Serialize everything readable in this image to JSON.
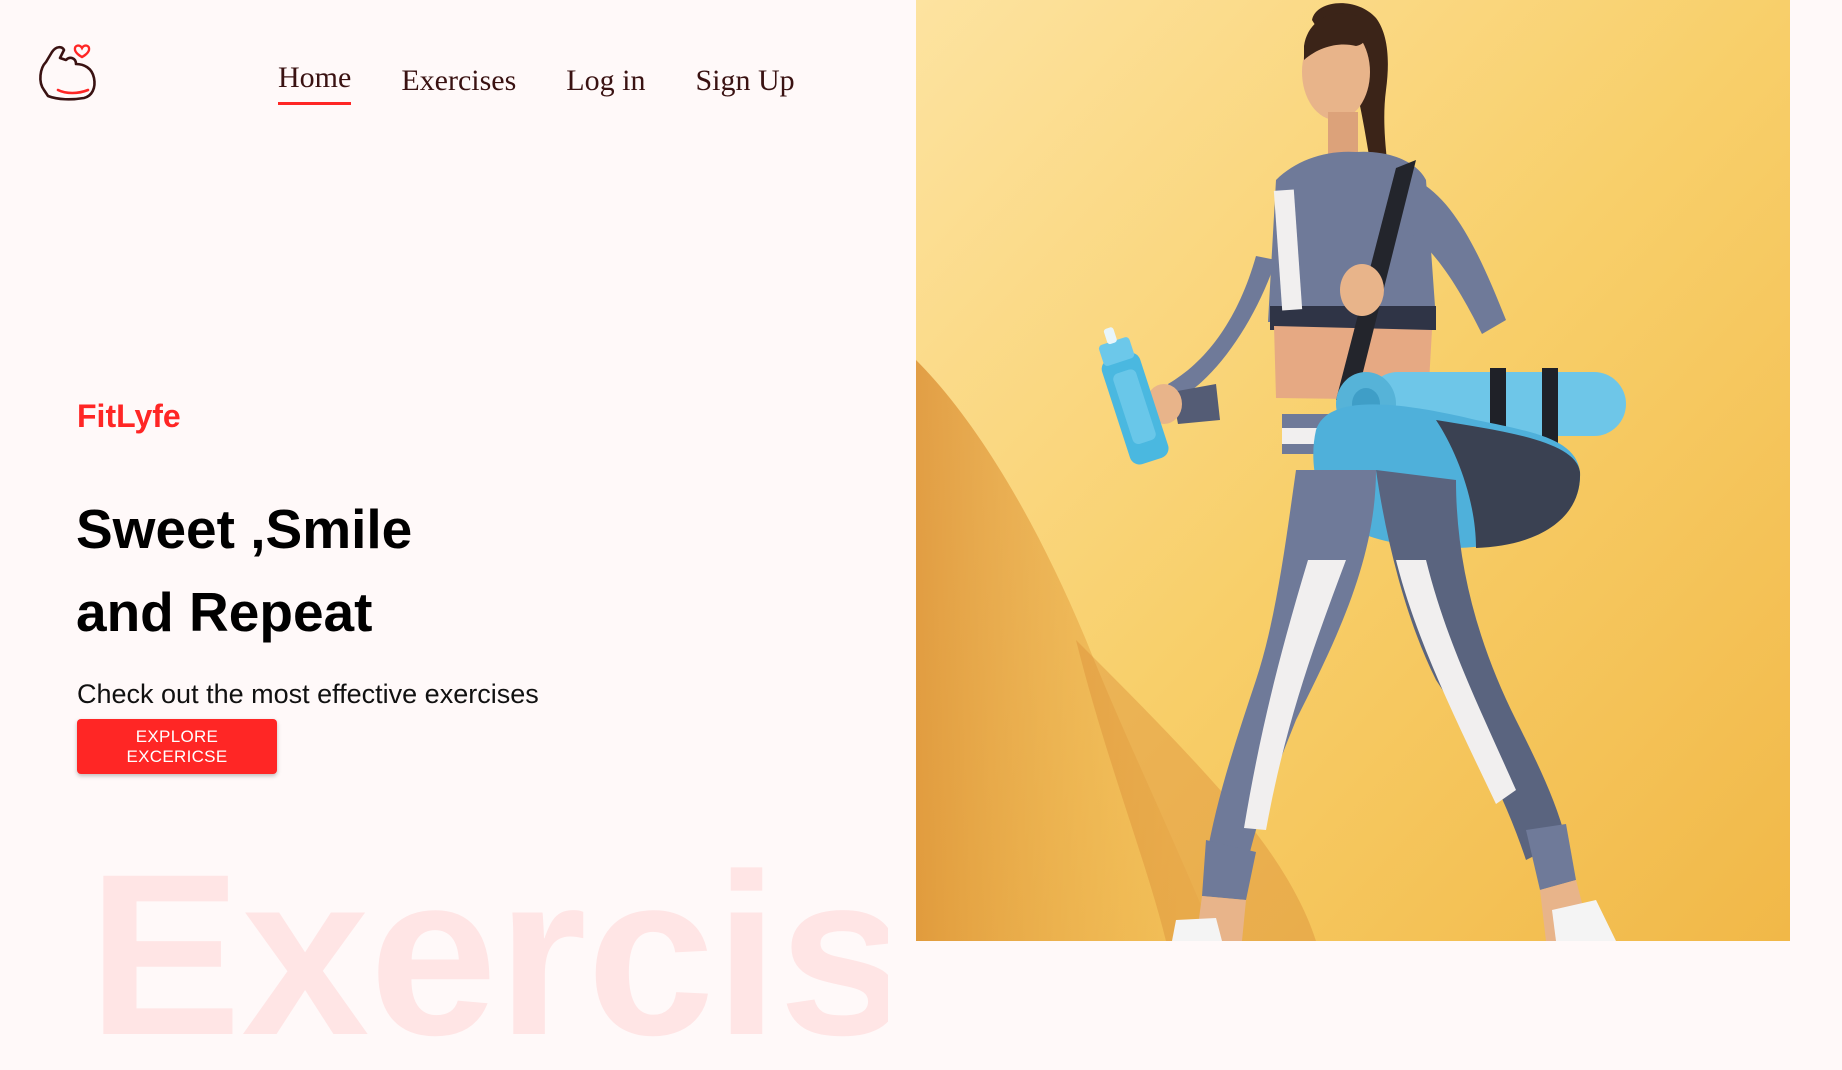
{
  "header": {
    "logo_icon": "flexed-arm-heart-icon",
    "nav": [
      {
        "label": "Home",
        "active": true
      },
      {
        "label": "Exercises",
        "active": false
      },
      {
        "label": "Log in",
        "active": false
      },
      {
        "label": "Sign Up",
        "active": false
      }
    ]
  },
  "hero": {
    "brand": "FitLyfe",
    "headline_line1": "Sweet ,Smile",
    "headline_line2": "and Repeat",
    "subtitle": "Check out the most effective exercises",
    "cta_label": "EXPLORE EXCERICSE",
    "watermark": "Exercise",
    "image_description_icon": "woman-walking-with-gym-bag-image"
  },
  "colors": {
    "accent": "#ff2625",
    "background": "#fff9f9",
    "hero_image_bg": "#f6c55a",
    "nav_text": "#3a1212"
  }
}
